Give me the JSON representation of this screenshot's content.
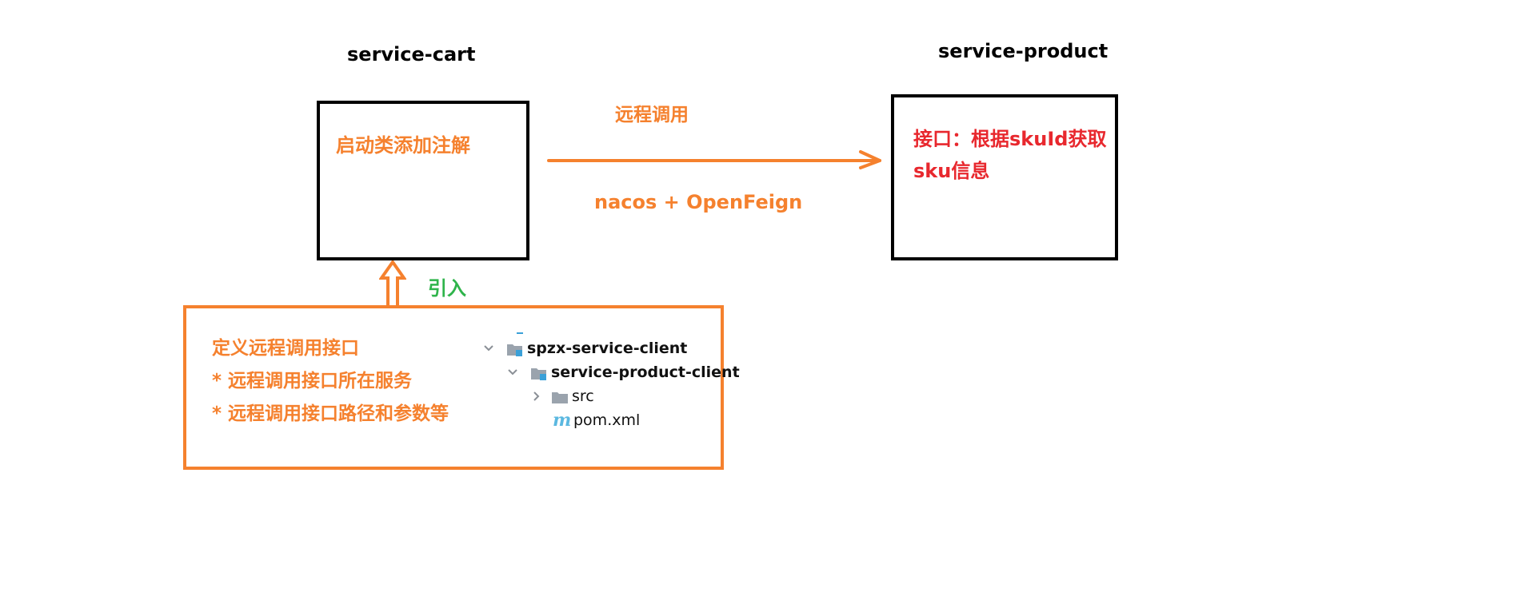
{
  "service_cart": {
    "title": "service-cart",
    "box_text": "启动类添加注解"
  },
  "service_product": {
    "title": "service-product",
    "box_lines": [
      "接口：根据skuId获取",
      "sku信息"
    ]
  },
  "remote_call": {
    "label": "远程调用",
    "mechanism": "nacos + OpenFeign"
  },
  "import_arrow": {
    "label": "引入"
  },
  "client_module": {
    "lines": [
      "定义远程调用接口",
      "* 远程调用接口所在服务",
      "* 远程调用接口路径和参数等"
    ],
    "tree": {
      "root": "spzx-service-client",
      "child": "service-product-client",
      "src": "src",
      "pom": "pom.xml",
      "pom_icon_glyph": "m"
    }
  },
  "colors": {
    "orange": "#f5812e",
    "red": "#e8282e",
    "green": "#2fb44b",
    "black": "#000000",
    "folder_gray": "#9aa3ad",
    "module_blue": "#3aa0d8"
  }
}
